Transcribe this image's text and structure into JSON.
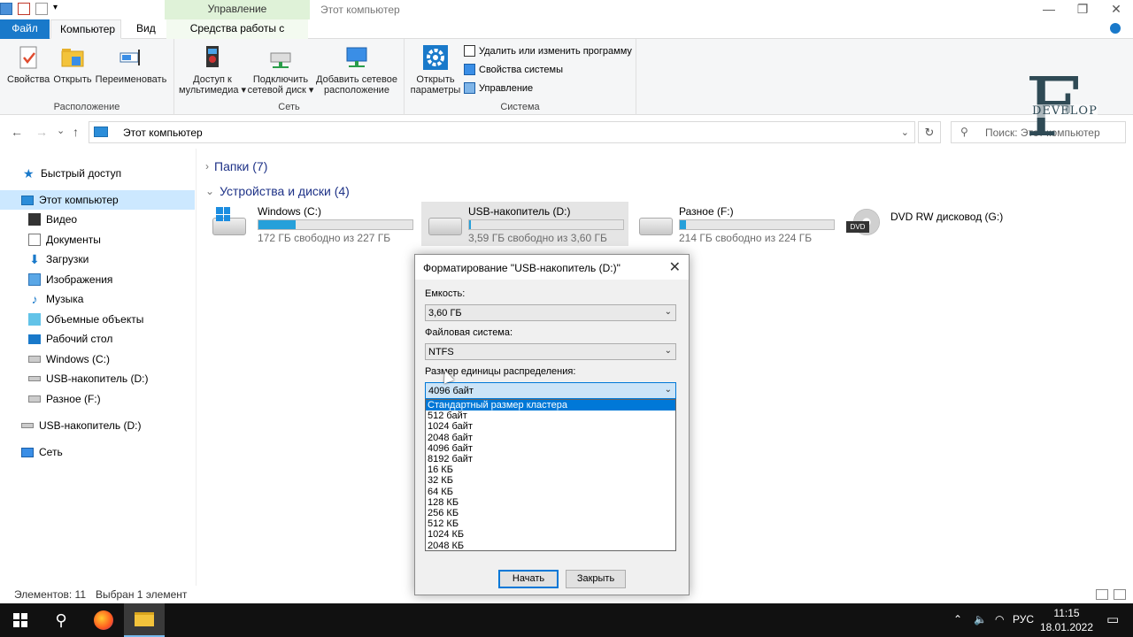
{
  "window": {
    "title": "Этот компьютер",
    "context_tab": "Управление",
    "min": "—",
    "max": "❐",
    "close": "✕"
  },
  "ribbon_tabs": {
    "file": "Файл",
    "computer": "Компьютер",
    "view": "Вид",
    "disk_tools": "Средства работы с дисками"
  },
  "ribbon": {
    "location": {
      "label": "Расположение",
      "properties": "Свойства",
      "open": "Открыть",
      "rename": "Переименовать"
    },
    "network": {
      "label": "Сеть",
      "media_1": "Доступ к",
      "media_2": "мультимедиа ▾",
      "map_1": "Подключить",
      "map_2": "сетевой диск ▾",
      "add_1": "Добавить сетевое",
      "add_2": "расположение"
    },
    "system": {
      "label": "Система",
      "open_1": "Открыть",
      "open_2": "параметры",
      "uninstall": "Удалить или изменить программу",
      "sysprops": "Свойства системы",
      "manage": "Управление"
    }
  },
  "address": {
    "path": "Этот компьютер",
    "search_placeholder": "Поиск: Этот компьютер",
    "back": "←",
    "forward": "→",
    "recent": "⌄",
    "up": "↑",
    "dropdown": "⌄",
    "refresh": "↻",
    "search_glyph": "⚲"
  },
  "logo": {
    "letter": "F",
    "text": "DEVELOP"
  },
  "sidebar": {
    "items": [
      {
        "label": "Быстрый доступ",
        "icon": "star-icon"
      },
      {
        "label": "Этот компьютер",
        "icon": "computer-icon"
      },
      {
        "label": "Видео",
        "icon": "video-icon"
      },
      {
        "label": "Документы",
        "icon": "documents-icon"
      },
      {
        "label": "Загрузки",
        "icon": "downloads-icon"
      },
      {
        "label": "Изображения",
        "icon": "pictures-icon"
      },
      {
        "label": "Музыка",
        "icon": "music-icon"
      },
      {
        "label": "Объемные объекты",
        "icon": "3d-objects-icon"
      },
      {
        "label": "Рабочий стол",
        "icon": "desktop-icon"
      },
      {
        "label": "Windows (C:)",
        "icon": "drive-icon"
      },
      {
        "label": "USB-накопитель (D:)",
        "icon": "usb-drive-icon"
      },
      {
        "label": "Разное (F:)",
        "icon": "drive-icon"
      },
      {
        "label": "USB-накопитель (D:)",
        "icon": "usb-drive-icon"
      },
      {
        "label": "Сеть",
        "icon": "network-icon"
      }
    ]
  },
  "main": {
    "folders_header": "Папки (7)",
    "devices_header": "Устройства и диски (4)",
    "collapsed_arrow": "›",
    "expanded_arrow": "⌄",
    "drives": [
      {
        "name": "Windows (C:)",
        "free": "172 ГБ свободно из 227 ГБ",
        "used_fraction": 0.24
      },
      {
        "name": "USB-накопитель (D:)",
        "free": "3,59 ГБ свободно из 3,60 ГБ",
        "used_fraction": 0.01
      },
      {
        "name": "Разное (F:)",
        "free": "214 ГБ свободно из 224 ГБ",
        "used_fraction": 0.04
      },
      {
        "name": "DVD RW дисковод (G:)",
        "badge": "DVD"
      }
    ]
  },
  "status": {
    "items": "Элементов: 11",
    "selected": "Выбран 1 элемент"
  },
  "dialog": {
    "title": "Форматирование \"USB-накопитель (D:)\"",
    "close": "✕",
    "capacity_label": "Емкость:",
    "capacity_value": "3,60 ГБ",
    "fs_label": "Файловая система:",
    "fs_value": "NTFS",
    "cluster_label": "Размер единицы распределения:",
    "cluster_value": "4096 байт",
    "combo_chevron": "⌄",
    "options": [
      "Стандартный размер кластера",
      "512 байт",
      "1024 байт",
      "2048 байт",
      "4096 байт",
      "8192 байт",
      "16 КБ",
      "32 КБ",
      "64 КБ",
      "128 КБ",
      "256 КБ",
      "512 КБ",
      "1024 КБ",
      "2048 КБ"
    ],
    "start_button": "Начать",
    "close_button": "Закрыть"
  },
  "taskbar": {
    "search_glyph": "⚲",
    "tray_up": "⌃",
    "volume": "🔈",
    "wifi": "◠",
    "lang": "РУС",
    "time": "11:15",
    "date": "18.01.2022",
    "notifications": "▭"
  },
  "colors": {
    "accent": "#0078d7",
    "file_tab": "#1979ca",
    "drive_bar": "#26a0da"
  }
}
